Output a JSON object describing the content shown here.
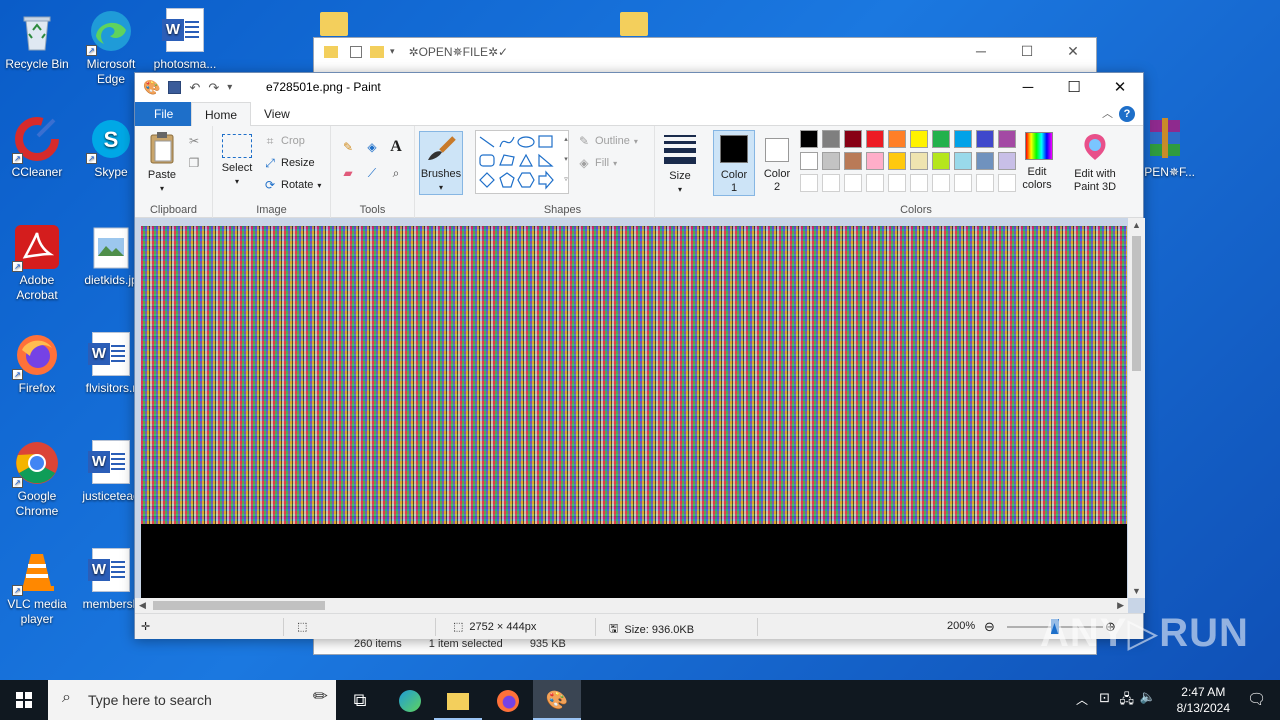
{
  "desktop": {
    "icons": [
      {
        "label": "Recycle Bin",
        "name": "recycle-bin"
      },
      {
        "label": "Microsoft Edge",
        "name": "microsoft-edge"
      },
      {
        "label": "photosma...",
        "name": "photosma-doc"
      },
      {
        "label": "CCleaner",
        "name": "ccleaner"
      },
      {
        "label": "Skype",
        "name": "skype"
      },
      {
        "label": "OPEN✵F...",
        "name": "winrar-archive"
      },
      {
        "label": "Adobe Acrobat",
        "name": "adobe-acrobat"
      },
      {
        "label": "dietkids.jp",
        "name": "dietkids-image"
      },
      {
        "label": "Firefox",
        "name": "firefox"
      },
      {
        "label": "flvisitors.r",
        "name": "flvisitors-doc"
      },
      {
        "label": "Google Chrome",
        "name": "google-chrome"
      },
      {
        "label": "justicetead",
        "name": "justicetead-doc"
      },
      {
        "label": "VLC media player",
        "name": "vlc-media-player"
      },
      {
        "label": "membersh",
        "name": "membersh-doc"
      }
    ]
  },
  "explorer": {
    "title": "✲OPEN✵FILE✲✓",
    "status_items": "260 items",
    "status_selected": "1 item selected",
    "status_size": "935 KB"
  },
  "paint": {
    "title": "e728501e.png - Paint",
    "tabs": {
      "file": "File",
      "home": "Home",
      "view": "View"
    },
    "clipboard": {
      "paste": "Paste",
      "group": "Clipboard"
    },
    "image": {
      "select": "Select",
      "crop": "Crop",
      "resize": "Resize",
      "rotate": "Rotate",
      "group": "Image"
    },
    "tools": {
      "group": "Tools"
    },
    "brushes": {
      "label": "Brushes"
    },
    "shapes": {
      "outline": "Outline",
      "fill": "Fill",
      "group": "Shapes"
    },
    "size": {
      "label": "Size"
    },
    "color1": {
      "label": "Color",
      "num": "1"
    },
    "color2": {
      "label": "Color",
      "num": "2"
    },
    "colors": {
      "group": "Colors",
      "edit": "Edit colors",
      "row1": [
        "#000000",
        "#7f7f7f",
        "#880015",
        "#ed1c24",
        "#ff7f27",
        "#fff200",
        "#22b14c",
        "#00a2e8",
        "#3f48cc",
        "#a349a4"
      ],
      "row2": [
        "#ffffff",
        "#c3c3c3",
        "#b97a57",
        "#ffaec9",
        "#ffc90e",
        "#efe4b0",
        "#b5e61d",
        "#99d9ea",
        "#7092be",
        "#c8bfe7"
      ]
    },
    "paint3d": {
      "label": "Edit with Paint 3D"
    },
    "status": {
      "dimensions": "2752 × 444px",
      "size": "Size: 936.0KB",
      "zoom": "200%"
    }
  },
  "taskbar": {
    "search_placeholder": "Type here to search",
    "time": "2:47 AM",
    "date": "8/13/2024"
  },
  "watermark": "ANY▷RUN"
}
